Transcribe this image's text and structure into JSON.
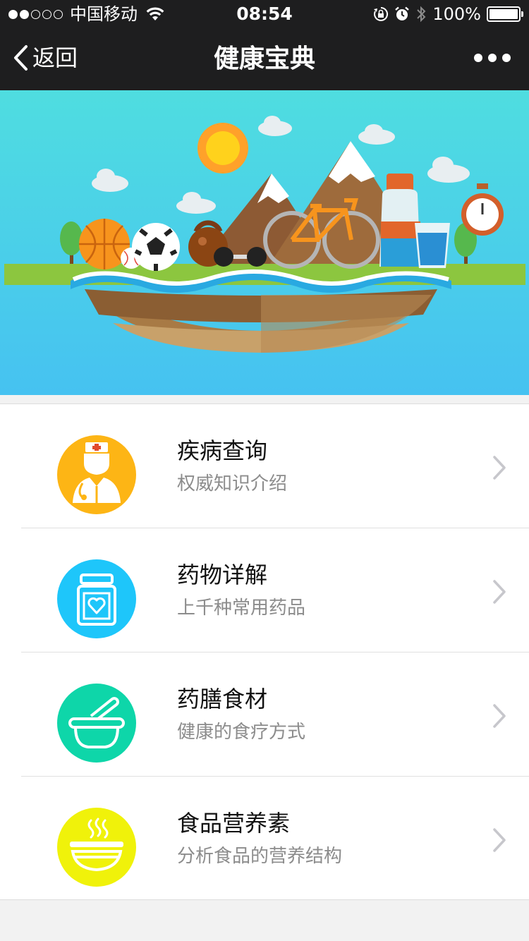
{
  "status_bar": {
    "carrier": "中国移动",
    "time": "08:54",
    "battery_text": "100%",
    "signal_dots_filled": 2,
    "signal_dots_total": 5
  },
  "nav": {
    "back_label": "返回",
    "title": "健康宝典"
  },
  "colors": {
    "nav_bg": "#1e1e1f",
    "banner_sky": "#4fd3e0",
    "disease_icon": "#fdb515",
    "drug_icon": "#1ec6fa",
    "food_icon": "#0ed6a9",
    "nutrition_icon": "#f0f20a"
  },
  "menu": [
    {
      "title": "疾病查询",
      "subtitle": "权威知识介绍",
      "icon": "doctor-icon"
    },
    {
      "title": "药物详解",
      "subtitle": "上千种常用药品",
      "icon": "medicine-bottle-icon"
    },
    {
      "title": "药膳食材",
      "subtitle": "健康的食疗方式",
      "icon": "mortar-pestle-icon"
    },
    {
      "title": "食品营养素",
      "subtitle": "分析食品的营养结构",
      "icon": "steaming-bowl-icon"
    }
  ]
}
